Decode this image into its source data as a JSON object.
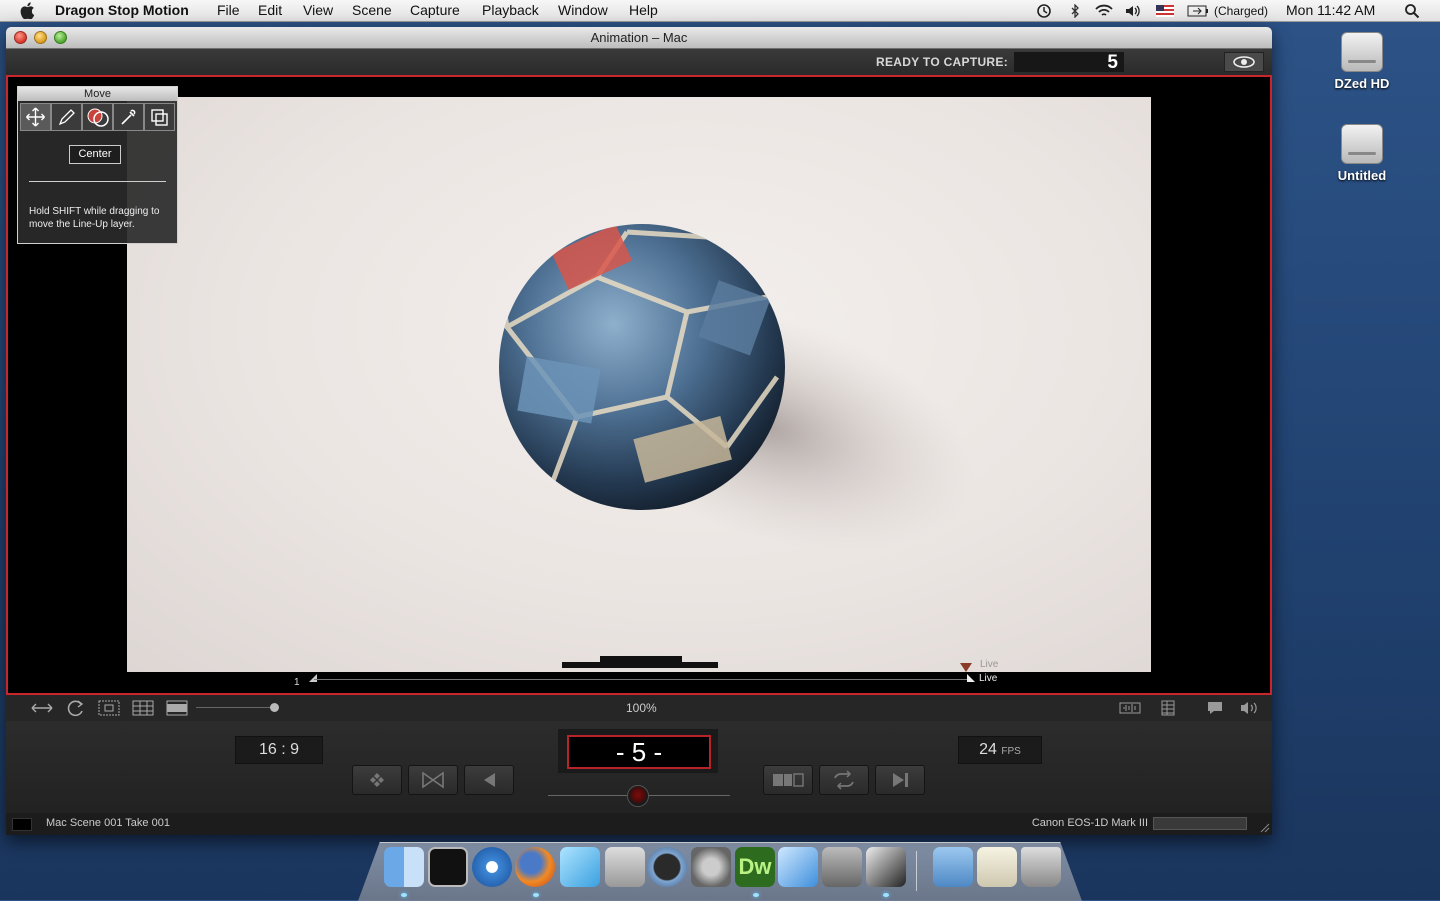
{
  "menubar": {
    "app_name": "Dragon Stop Motion",
    "menus": [
      "File",
      "Edit",
      "View",
      "Scene",
      "Capture",
      "Playback",
      "Window",
      "Help"
    ],
    "battery": "(Charged)",
    "clock": "Mon 11:42 AM"
  },
  "window": {
    "title": "Animation – Mac"
  },
  "capture": {
    "label": "READY TO CAPTURE:",
    "count": "5"
  },
  "tool_palette": {
    "title": "Move",
    "center_label": "Center",
    "hint": "Hold SHIFT while dragging to move the Line-Up layer."
  },
  "timeline": {
    "start": "1",
    "live_top": "Live",
    "live_bottom": "Live"
  },
  "view_toolbar": {
    "zoom": "100%"
  },
  "transport": {
    "aspect_ratio": "16 : 9",
    "frame_counter": "- 5 -",
    "fps_value": "24",
    "fps_unit": "FPS"
  },
  "status_bar": {
    "project": "Mac  Scene 001  Take 001",
    "camera": "Canon EOS-1D Mark III"
  },
  "desktop": {
    "icons": [
      "DZed HD",
      "Untitled"
    ]
  },
  "colors": {
    "capture_border": "#c9252d",
    "desktop_blue": "#234676"
  }
}
